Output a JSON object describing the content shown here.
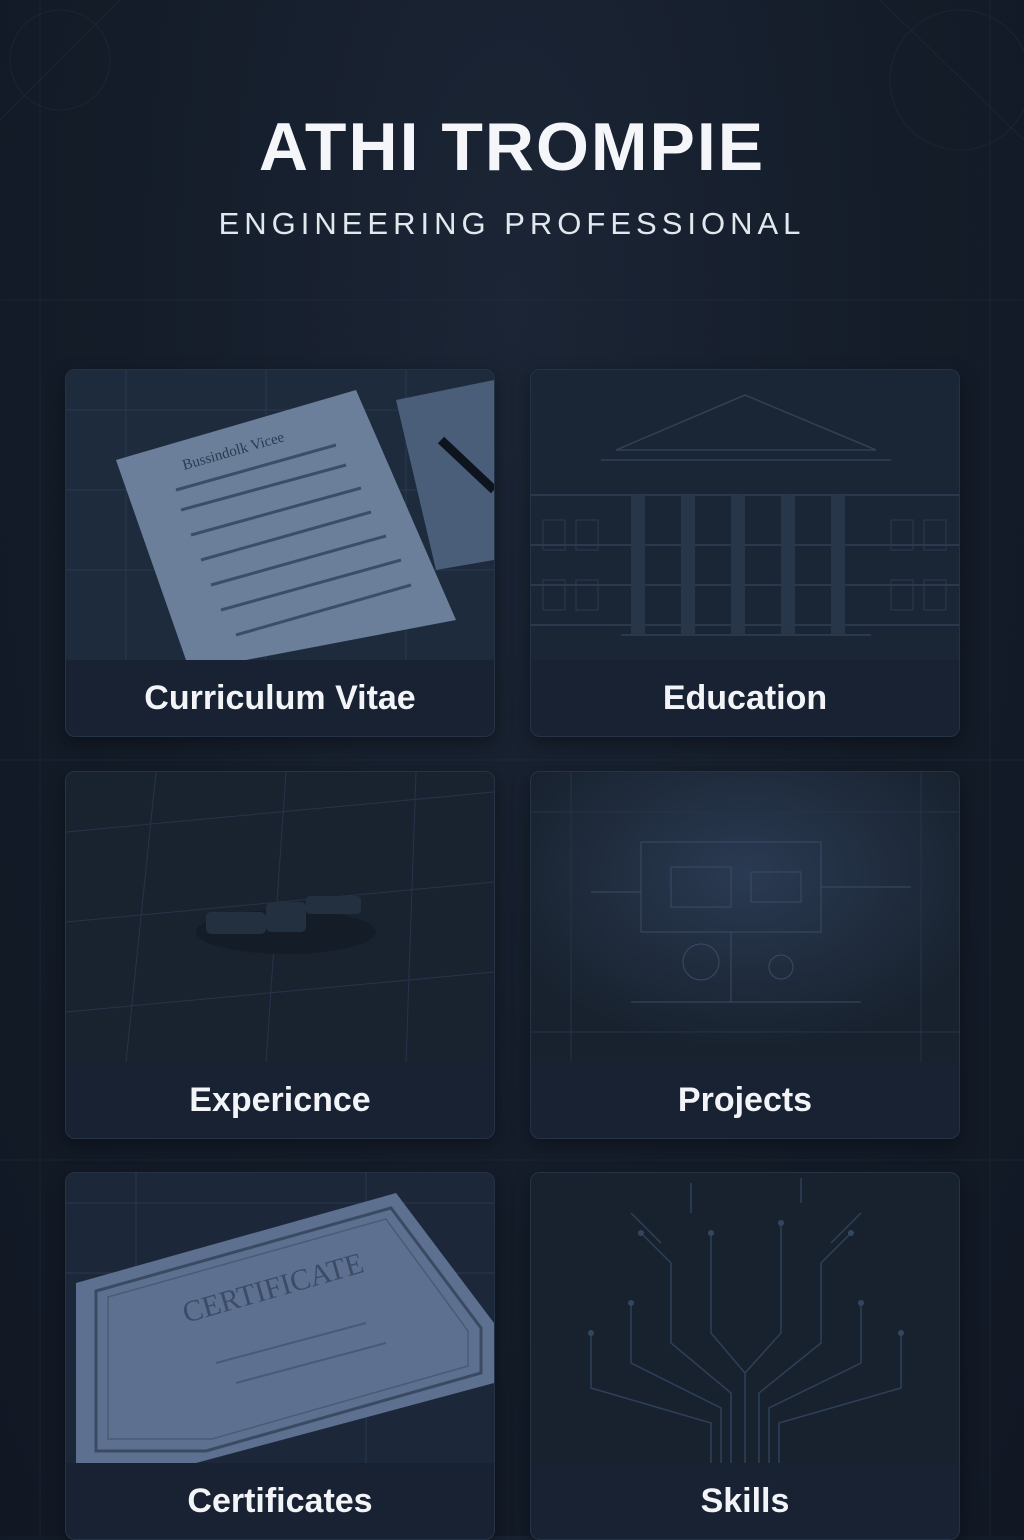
{
  "header": {
    "name": "ATHI TROMPIE",
    "role": "ENGINEERING PROFESSIONAL"
  },
  "cards": [
    {
      "label": "Curriculum Vitae",
      "icon": "document-icon",
      "image_text": "Bussindolk Vicee"
    },
    {
      "label": "Education",
      "icon": "building-icon"
    },
    {
      "label": "Expericnce",
      "icon": "tool-icon"
    },
    {
      "label": "Projects",
      "icon": "blueprint-icon"
    },
    {
      "label": "Certificates",
      "icon": "certificate-icon",
      "image_text": "CERTIFICATE"
    },
    {
      "label": "Skills",
      "icon": "circuit-icon"
    }
  ],
  "colors": {
    "background": "#141c29",
    "card": "#182232",
    "text": "#f2f4f8"
  }
}
